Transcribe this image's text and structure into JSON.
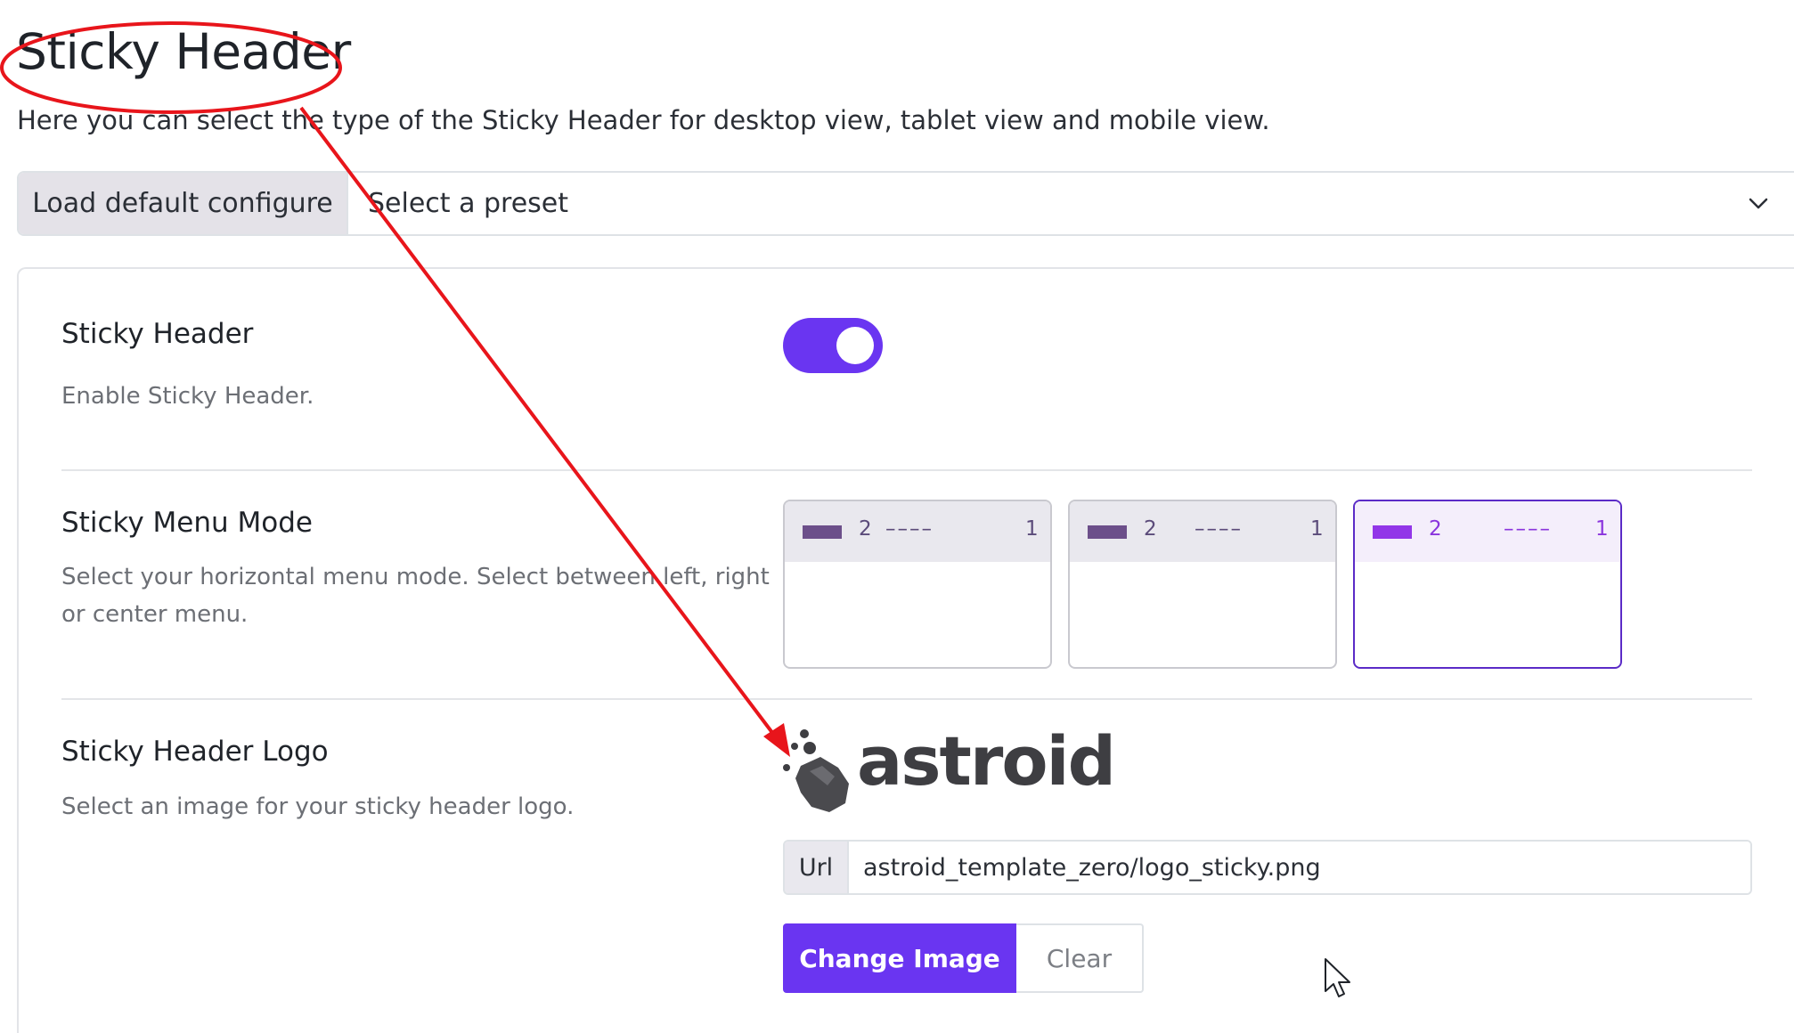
{
  "page": {
    "title": "Sticky Header",
    "description": "Here you can select the type of the Sticky Header for desktop view, tablet view and mobile view."
  },
  "preset": {
    "button_label": "Load default configure",
    "select_value": "Select a preset"
  },
  "sticky_header": {
    "title": "Sticky Header",
    "description": "Enable Sticky Header.",
    "enabled": true
  },
  "menu_mode": {
    "title": "Sticky Menu Mode",
    "description_line1": "Select your horizontal menu mode. Select between left, right",
    "description_line2": "or center menu.",
    "options": [
      {
        "logo_num": "2",
        "dashes": "––––",
        "end_num": "1",
        "selected": false
      },
      {
        "logo_num": "2",
        "dashes": "––––",
        "end_num": "1",
        "selected": false
      },
      {
        "logo_num": "2",
        "dashes": "––––",
        "end_num": "1",
        "selected": true
      }
    ]
  },
  "logo_field": {
    "title": "Sticky Header Logo",
    "description": "Select an image for your sticky header logo.",
    "preview_text": "astroid",
    "url_label": "Url",
    "url_value": "astroid_template_zero/logo_sticky.png",
    "change_label": "Change Image",
    "clear_label": "Clear"
  },
  "colors": {
    "accent": "#6a35f1",
    "annotation": "#e8151b",
    "selected_mode": "#9236e8"
  },
  "icons": [
    "chevron-down-icon",
    "asteroid-icon",
    "mouse-cursor-icon",
    "annotation-arrow",
    "annotation-circle"
  ]
}
